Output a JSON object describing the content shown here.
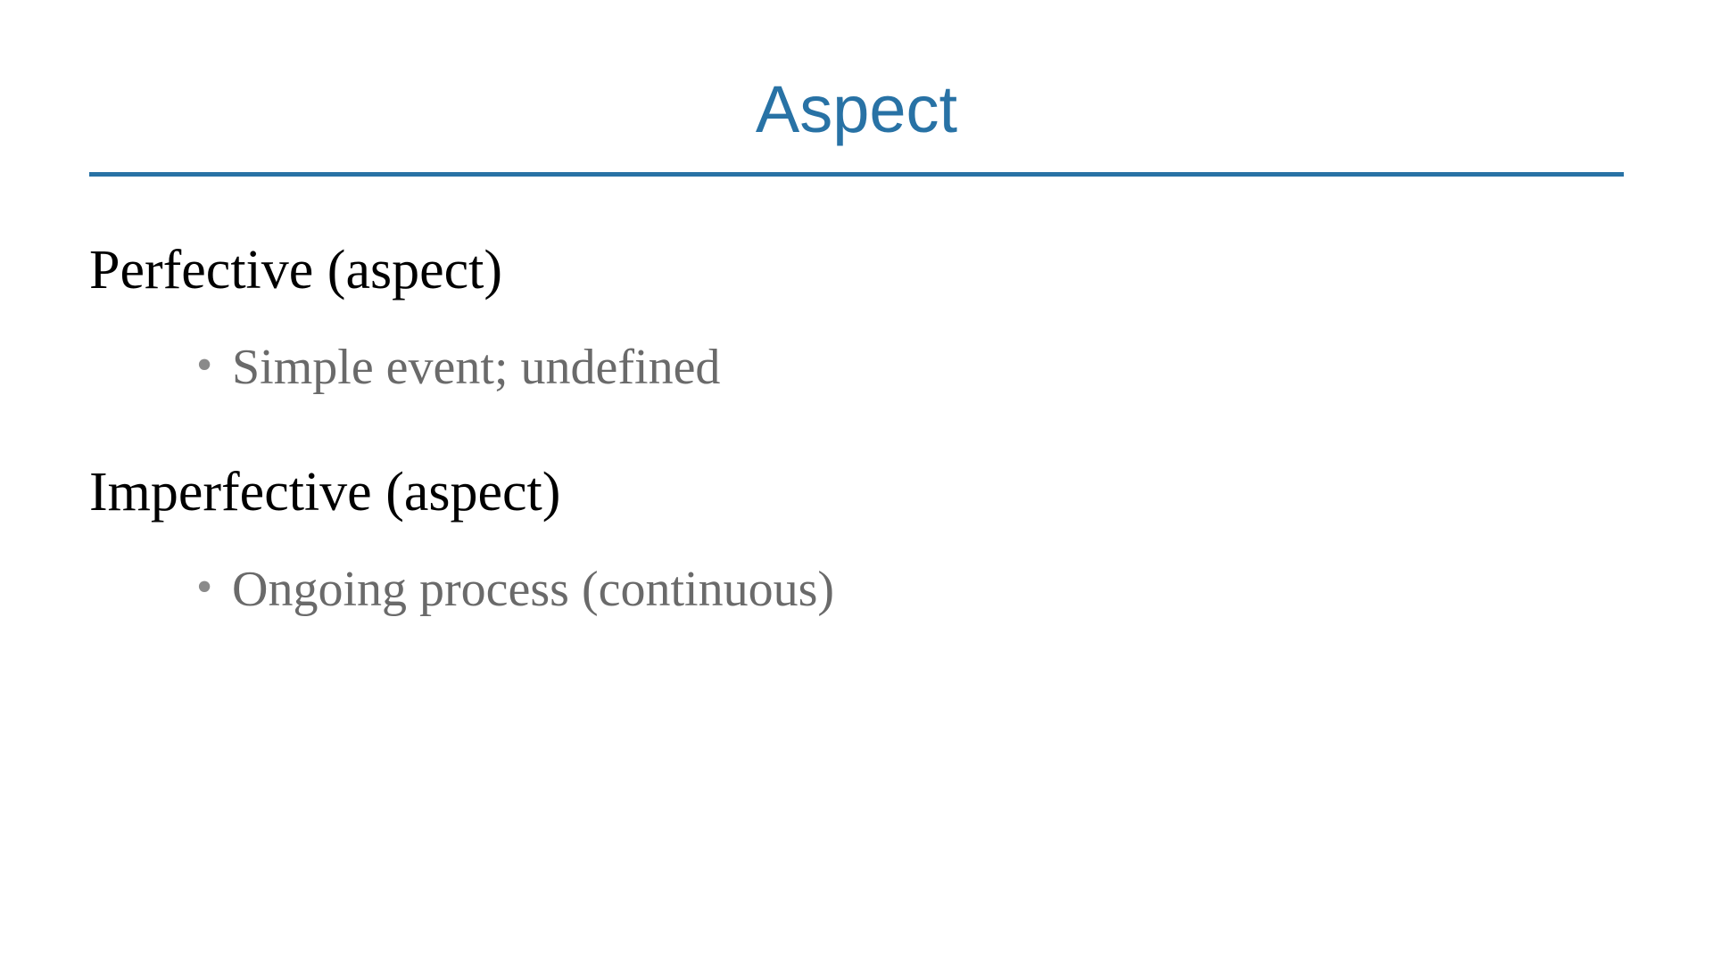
{
  "colors": {
    "accent": "#2872a5",
    "body_text": "#000000",
    "bullet_text": "#6a6a6a"
  },
  "slide": {
    "title": "Aspect",
    "sections": [
      {
        "heading": "Perfective (aspect)",
        "bullets": [
          "Simple event; undefined"
        ]
      },
      {
        "heading": "Imperfective (aspect)",
        "bullets": [
          "Ongoing process (continuous)"
        ]
      }
    ]
  }
}
